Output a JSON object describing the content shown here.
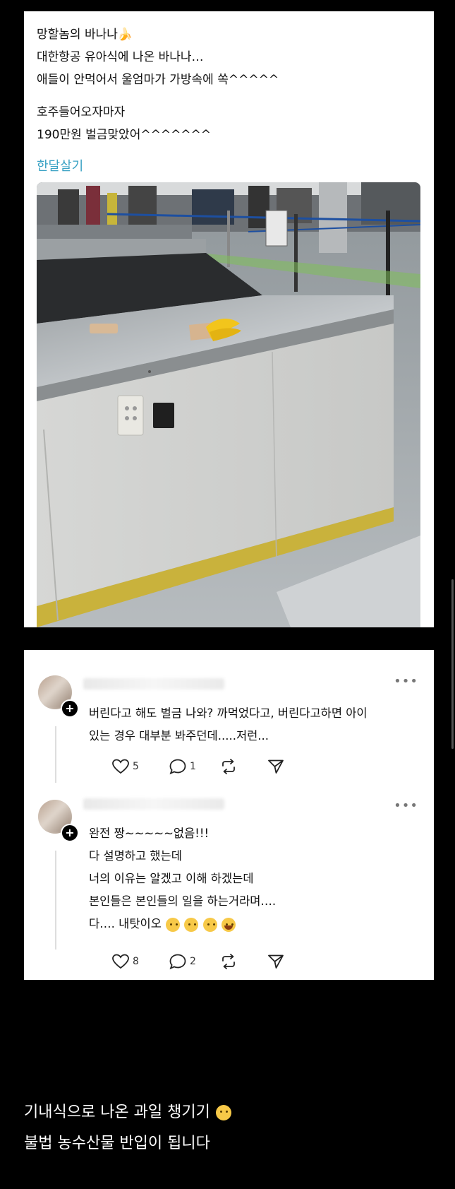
{
  "post": {
    "lines": [
      "망할놈의 바나나🍌",
      "대한항공 유아식에 나온 바나나…",
      "애들이 안먹어서 울엄마가 가방속에 쏙^^^^^",
      "호주들어오자마자",
      "190만원 벌금맞았어^^^^^^^"
    ],
    "hashtag": "한달살기"
  },
  "comments": [
    {
      "text": [
        "버린다고 해도 벌금 나와? 까먹었다고, 버린다고하면 아이",
        "있는 경우 대부분 봐주던데.....저런..."
      ],
      "likes": "5",
      "replies": "1"
    },
    {
      "text": [
        "완전 짱~~~~~없음!!!",
        "다 설명하고 했는데",
        "너의 이유는 알겠고 이해 하겠는데",
        "본인들은 본인들의 일을 하는거라며….",
        "다…. 내탓이오"
      ],
      "likes": "8",
      "replies": "2"
    }
  ],
  "bottom": {
    "line1": "기내식으로 나온 과일 챙기기",
    "line2": "불법 농수산물 반입이 됩니다"
  },
  "icons": {
    "more": "more-dots-icon",
    "like": "heart-icon",
    "reply": "comment-bubble-icon",
    "repost": "repost-icon",
    "share": "send-icon",
    "plus": "follow-plus-icon"
  },
  "colors": {
    "background": "#000000",
    "card": "#ffffff",
    "hashtag": "#3aa2c4"
  }
}
